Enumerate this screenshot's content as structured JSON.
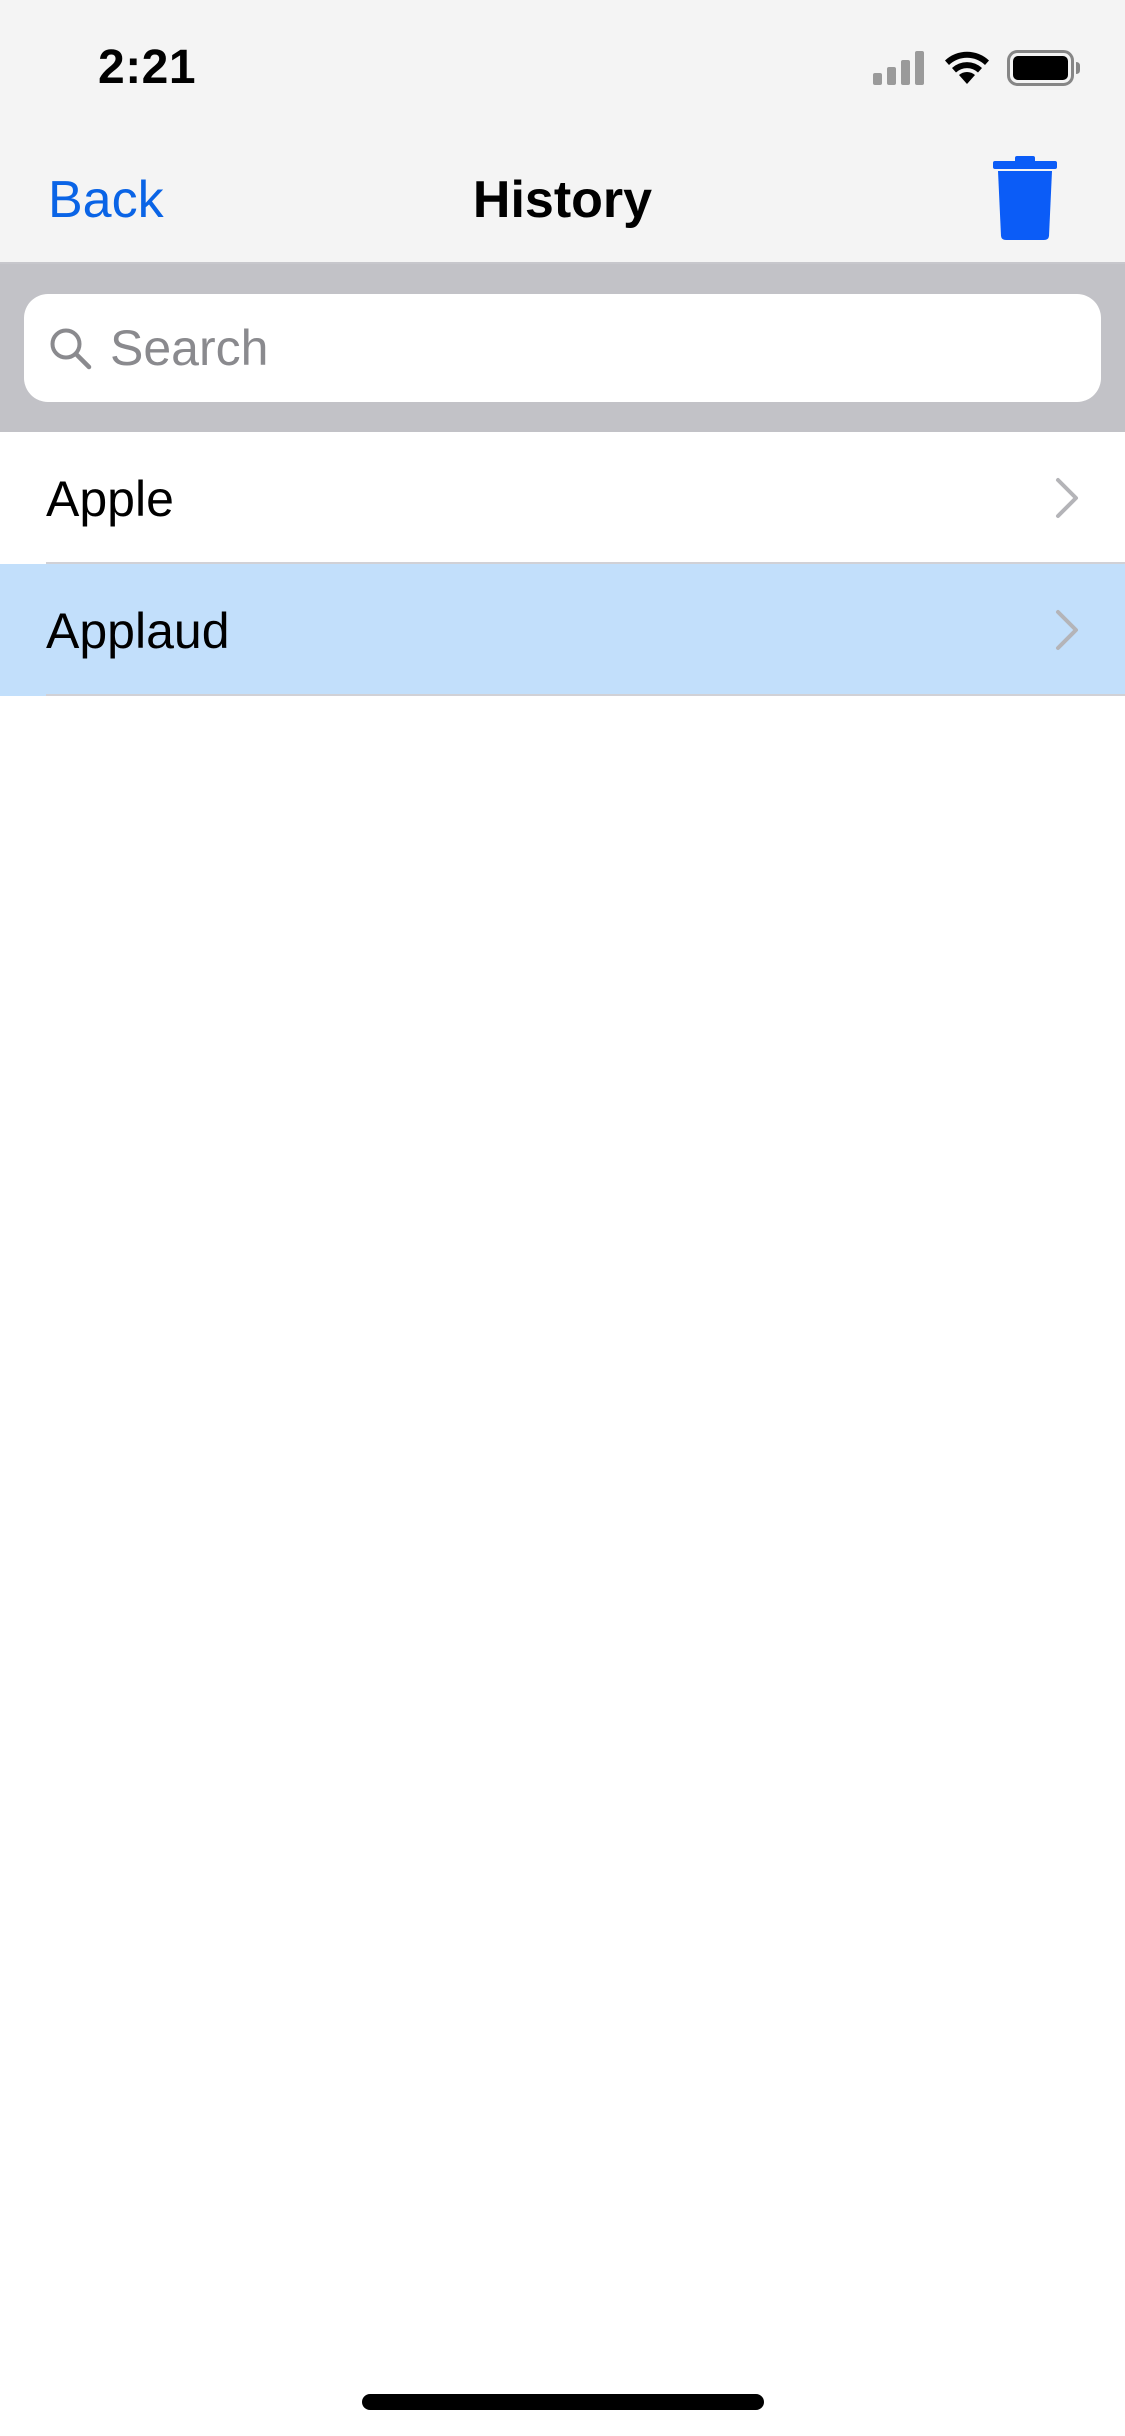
{
  "status_bar": {
    "time": "2:21",
    "icons": [
      "cellular-signal-icon",
      "wifi-icon",
      "battery-icon"
    ]
  },
  "nav_bar": {
    "back_label": "Back",
    "title": "History",
    "trash_icon": "trash-icon"
  },
  "search": {
    "placeholder": "Search",
    "value": ""
  },
  "list": {
    "items": [
      {
        "label": "Apple",
        "selected": false
      },
      {
        "label": "Applaud",
        "selected": true
      }
    ]
  },
  "colors": {
    "accent": "#0a64e6",
    "trash": "#0b5cf7",
    "selected_row": "#c2dffb",
    "bar_background": "#f4f4f4",
    "search_background": "#c2c2c7"
  }
}
